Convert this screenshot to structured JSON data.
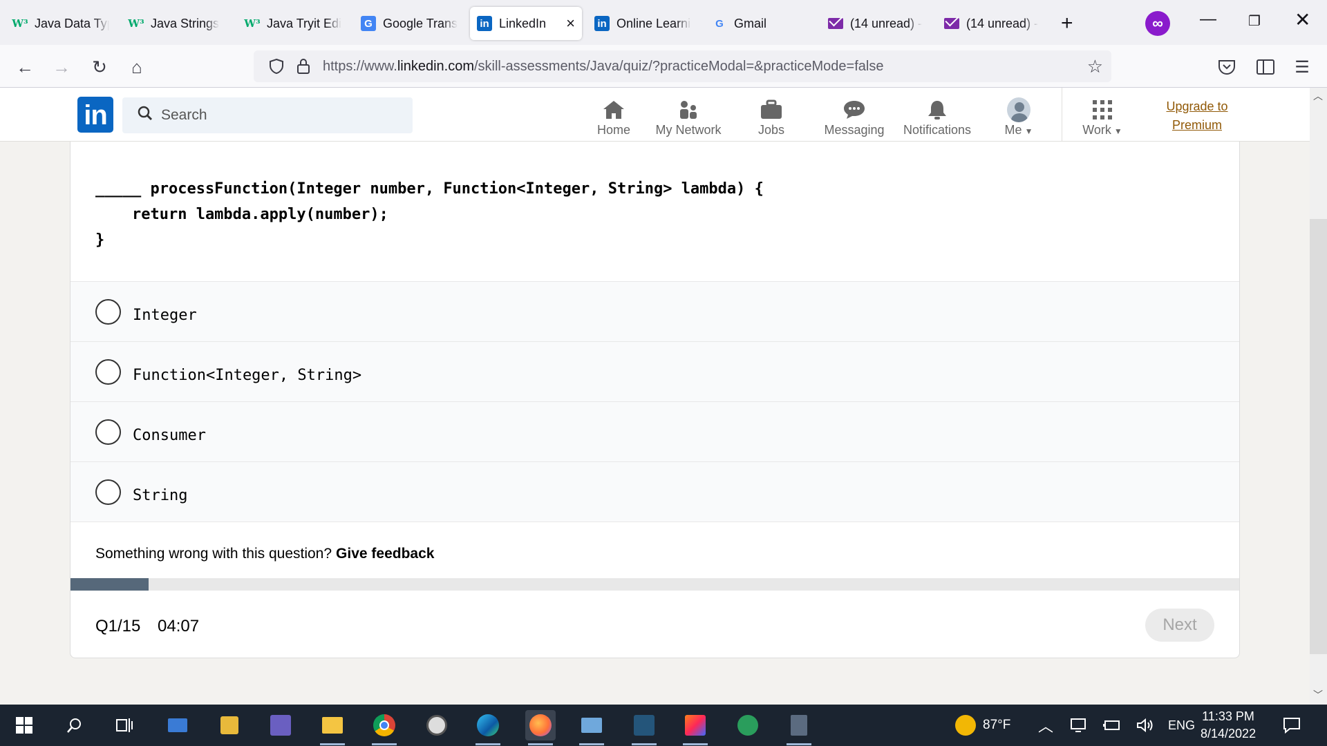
{
  "browser": {
    "tabs": [
      {
        "title": "Java Data Types",
        "icon": "w3schools-icon",
        "glyph": "W³"
      },
      {
        "title": "Java Strings",
        "icon": "w3schools-icon",
        "glyph": "W³"
      },
      {
        "title": "Java Tryit Editor",
        "icon": "w3schools-icon",
        "glyph": "W³"
      },
      {
        "title": "Google Translate",
        "icon": "google-translate-icon",
        "glyph": "G"
      },
      {
        "title": "LinkedIn",
        "icon": "linkedin-icon",
        "glyph": "in",
        "active": true
      },
      {
        "title": "Online Learning",
        "icon": "linkedin-icon",
        "glyph": "in"
      },
      {
        "title": "Gmail",
        "icon": "google-icon",
        "glyph": "G"
      },
      {
        "title": "(14 unread) -",
        "icon": "mail-icon",
        "glyph": ""
      },
      {
        "title": "(14 unread) -",
        "icon": "mail-icon",
        "glyph": ""
      }
    ],
    "active_tab_close": "×",
    "new_tab": "+",
    "url_prefix": "https://www.",
    "url_domain": "linkedin.com",
    "url_path": "/skill-assessments/Java/quiz/?practiceModal=&practiceMode=false"
  },
  "linkedin": {
    "logo": "in",
    "search_placeholder": "Search",
    "nav": [
      {
        "label": "Home",
        "icon": "home-icon"
      },
      {
        "label": "My Network",
        "icon": "network-icon"
      },
      {
        "label": "Jobs",
        "icon": "briefcase-icon"
      },
      {
        "label": "Messaging",
        "icon": "messaging-icon"
      },
      {
        "label": "Notifications",
        "icon": "bell-icon"
      },
      {
        "label": "Me",
        "icon": "avatar"
      },
      {
        "label": "Work",
        "icon": "grid-icon"
      }
    ],
    "premium_line1": "Upgrade to",
    "premium_line2": "Premium"
  },
  "quiz": {
    "code_lines": [
      "_____ processFunction(Integer number, Function<Integer, String> lambda) {",
      "    return lambda.apply(number);",
      "}"
    ],
    "options": [
      "Integer",
      "Function<Integer, String>",
      "Consumer",
      "String"
    ],
    "feedback_text": "Something wrong with this question?",
    "feedback_link": "Give feedback",
    "progress_fraction": 0.067,
    "question_counter": "Q1/15",
    "timer": "04:07",
    "next_label": "Next"
  },
  "taskbar": {
    "weather": "87°F",
    "language": "ENG",
    "time": "11:33 PM",
    "date": "8/14/2022"
  },
  "colors": {
    "linkedin_blue": "#0a66c2",
    "premium_gold": "#915907",
    "progress": "#56687a"
  }
}
